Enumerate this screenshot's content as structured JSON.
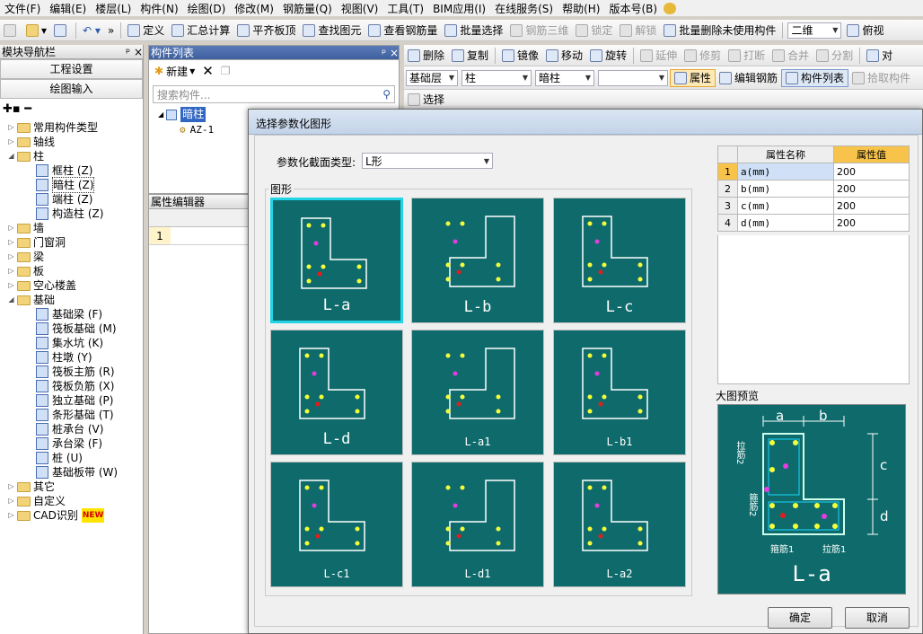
{
  "menu": [
    "文件(F)",
    "编辑(E)",
    "楼层(L)",
    "构件(N)",
    "绘图(D)",
    "修改(M)",
    "钢筋量(Q)",
    "视图(V)",
    "工具(T)",
    "BIM应用(I)",
    "在线服务(S)",
    "帮助(H)",
    "版本号(B)"
  ],
  "toolbar1": {
    "buttons": [
      "定义",
      "汇总计算",
      "平齐板顶",
      "查找图元",
      "查看钢筋量",
      "批量选择",
      "钢筋三维",
      "锁定",
      "解锁",
      "批量删除未使用构件"
    ],
    "view_mode": "二维",
    "view_dir": "俯视"
  },
  "nav": {
    "title": "模块导航栏",
    "pin": "ᵖ ×",
    "btn_project": "工程设置",
    "btn_draw": "绘图输入",
    "tree": [
      {
        "label": "常用构件类型",
        "level": 0,
        "type": "folder",
        "exp": "+"
      },
      {
        "label": "轴线",
        "level": 0,
        "type": "folder",
        "exp": "+"
      },
      {
        "label": "柱",
        "level": 0,
        "type": "folder",
        "exp": "-"
      },
      {
        "label": "框柱 (Z)",
        "level": 1,
        "type": "leaf"
      },
      {
        "label": "暗柱 (Z)",
        "level": 1,
        "type": "leaf",
        "selected": true
      },
      {
        "label": "端柱 (Z)",
        "level": 1,
        "type": "leaf"
      },
      {
        "label": "构造柱 (Z)",
        "level": 1,
        "type": "leaf"
      },
      {
        "label": "墙",
        "level": 0,
        "type": "folder",
        "exp": "+"
      },
      {
        "label": "门窗洞",
        "level": 0,
        "type": "folder",
        "exp": "+"
      },
      {
        "label": "梁",
        "level": 0,
        "type": "folder",
        "exp": "+"
      },
      {
        "label": "板",
        "level": 0,
        "type": "folder",
        "exp": "+"
      },
      {
        "label": "空心楼盖",
        "level": 0,
        "type": "folder",
        "exp": "+"
      },
      {
        "label": "基础",
        "level": 0,
        "type": "folder",
        "exp": "-"
      },
      {
        "label": "基础梁 (F)",
        "level": 1,
        "type": "leaf"
      },
      {
        "label": "筏板基础 (M)",
        "level": 1,
        "type": "leaf"
      },
      {
        "label": "集水坑 (K)",
        "level": 1,
        "type": "leaf"
      },
      {
        "label": "柱墩 (Y)",
        "level": 1,
        "type": "leaf"
      },
      {
        "label": "筏板主筋 (R)",
        "level": 1,
        "type": "leaf"
      },
      {
        "label": "筏板负筋 (X)",
        "level": 1,
        "type": "leaf"
      },
      {
        "label": "独立基础 (P)",
        "level": 1,
        "type": "leaf"
      },
      {
        "label": "条形基础 (T)",
        "level": 1,
        "type": "leaf"
      },
      {
        "label": "桩承台 (V)",
        "level": 1,
        "type": "leaf"
      },
      {
        "label": "承台梁 (F)",
        "level": 1,
        "type": "leaf"
      },
      {
        "label": "桩 (U)",
        "level": 1,
        "type": "leaf"
      },
      {
        "label": "基础板带 (W)",
        "level": 1,
        "type": "leaf"
      },
      {
        "label": "其它",
        "level": 0,
        "type": "folder",
        "exp": "+"
      },
      {
        "label": "自定义",
        "level": 0,
        "type": "folder",
        "exp": "+"
      },
      {
        "label": "CAD识别",
        "level": 0,
        "type": "folder",
        "exp": "+",
        "badge": "NEW"
      }
    ]
  },
  "clist": {
    "title": "构件列表",
    "new_btn": "新建",
    "search_placeholder": "搜索构件...",
    "root": "暗柱",
    "child": "AZ-1"
  },
  "cedit": {
    "title": "属性编辑器",
    "col": "属性名称",
    "row1": "1"
  },
  "rtop": {
    "row1": [
      "删除",
      "复制",
      "镜像",
      "移动",
      "旋转",
      "延伸",
      "修剪",
      "打断",
      "合并",
      "分割",
      "对"
    ],
    "floor": "基础层",
    "category": "柱",
    "type": "暗柱",
    "btn_attr": "属性",
    "btn_edit": "编辑钢筋",
    "btn_list": "构件列表",
    "btn_pick": "拾取构件",
    "row3": [
      "选择"
    ]
  },
  "dialog": {
    "title": "选择参数化图形",
    "type_label": "参数化截面类型:",
    "type_value": "L形",
    "group_label": "图形",
    "tiles": [
      "L-a",
      "L-b",
      "L-c",
      "L-d",
      "L-a1",
      "L-b1",
      "L-c1",
      "L-d1",
      "L-a2"
    ],
    "prop_hdr_name": "属性名称",
    "prop_hdr_val": "属性值",
    "props": [
      {
        "n": "1",
        "name": "a(mm)",
        "val": "200"
      },
      {
        "n": "2",
        "name": "b(mm)",
        "val": "200"
      },
      {
        "n": "3",
        "name": "c(mm)",
        "val": "200"
      },
      {
        "n": "4",
        "name": "d(mm)",
        "val": "200"
      }
    ],
    "preview_label": "大图预览",
    "preview_tag": "L-a",
    "preview_texts": {
      "a": "a",
      "b": "b",
      "c": "c",
      "d": "d",
      "lajin": "拉筋2",
      "gujin": "箍筋2",
      "gu1": "箍筋1",
      "la1": "拉筋1"
    },
    "ok": "确定",
    "cancel": "取消"
  }
}
